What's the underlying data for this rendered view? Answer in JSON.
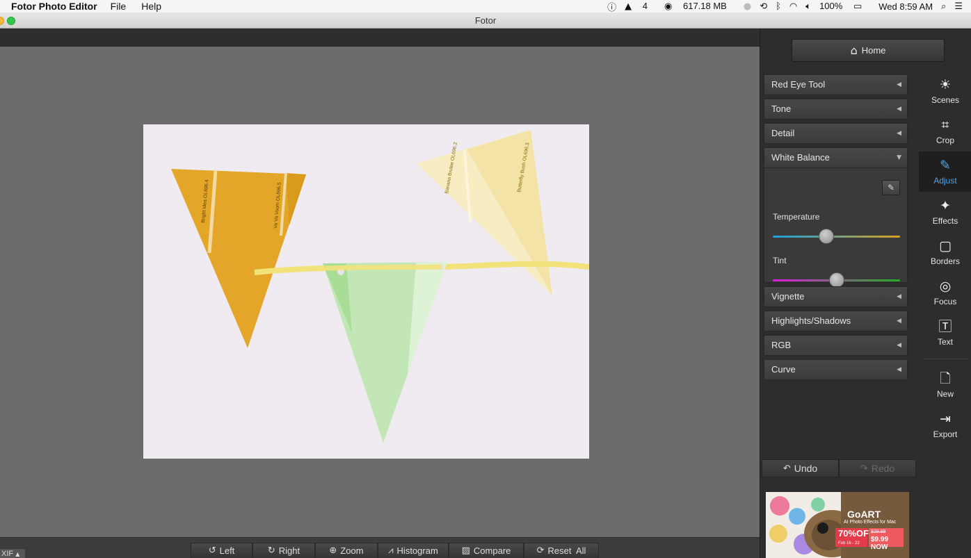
{
  "menubar": {
    "app_name": "Fotor Photo Editor",
    "menus": [
      "File",
      "Help"
    ],
    "status": {
      "adobe_count": "4",
      "memory": "617.18 MB",
      "battery": "100%",
      "clock": "Wed 8:59 AM"
    }
  },
  "window": {
    "title": "Fotor"
  },
  "right_panel": {
    "home_label": "Home",
    "sections": {
      "red_eye": "Red Eye Tool",
      "tone": "Tone",
      "detail": "Detail",
      "white_balance": "White Balance",
      "vignette": "Vignette",
      "highlights": "Highlights/Shadows",
      "rgb": "RGB",
      "curve": "Curve"
    },
    "white_balance": {
      "temperature_label": "Temperature",
      "temperature_value": 0.42,
      "tint_label": "Tint",
      "tint_value": 0.5
    },
    "tools": {
      "scenes": "Scenes",
      "crop": "Crop",
      "adjust": "Adjust",
      "effects": "Effects",
      "borders": "Borders",
      "focus": "Focus",
      "text": "Text",
      "new": "New",
      "export": "Export"
    },
    "active_tool": "Adjust",
    "accent_color": "#4fa3ea",
    "undo_label": "Undo",
    "redo_label": "Redo",
    "ad": {
      "brand": "GoART",
      "tagline": "AI Photo Effects for Mac",
      "discount": "70%OFF",
      "dates": "Feb 16 - 22",
      "old_price": "$29.99",
      "new_price": "$9.99 NOW"
    }
  },
  "bottom_bar": {
    "exif_label": "XIF",
    "buttons": {
      "left": "Left",
      "right": "Right",
      "zoom": "Zoom",
      "histogram": "Histogram",
      "compare": "Compare",
      "reset_all": "Reset  All"
    }
  },
  "photo": {
    "flag_labels": [
      "Bright Idea OL696.4",
      "Va Va Voom OL696.5",
      "Banana Brulee OL696.2",
      "Butterfly Bush OL696.3"
    ]
  }
}
